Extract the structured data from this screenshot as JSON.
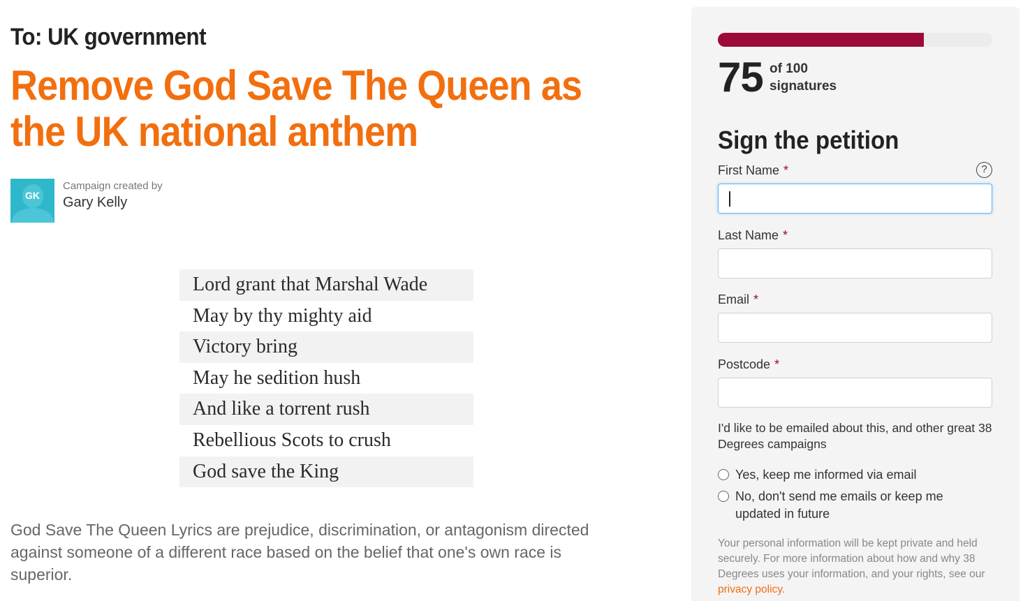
{
  "petition": {
    "to_line": "To: UK government",
    "title": "Remove God Save The Queen as the UK national anthem",
    "creator_label": "Campaign created by",
    "creator_name": "Gary Kelly",
    "creator_initials": "GK",
    "lyrics": [
      "Lord grant that Marshal Wade",
      "May by thy mighty aid",
      "Victory bring",
      "May he sedition hush",
      "And like a torrent rush",
      "Rebellious Scots to crush",
      "God save the King"
    ],
    "description": "God Save The Queen Lyrics are prejudice, discrimination, or antagonism directed against someone of a different race based on the belief that one's own race is superior."
  },
  "progress": {
    "count": "75",
    "of_label": "of 100",
    "signatures_label": "signatures",
    "fraction": 0.75,
    "fill_color": "#9b0a38"
  },
  "form": {
    "title": "Sign the petition",
    "required_mark": "*",
    "help_icon": "?",
    "first_name_label": "First Name",
    "last_name_label": "Last Name",
    "email_label": "Email",
    "postcode_label": "Postcode",
    "optin_text": "I'd like to be emailed about this, and other great 38 Degrees campaigns",
    "option_yes": "Yes, keep me informed via email",
    "option_no": "No, don't send me emails or keep me updated in future",
    "privacy_text": "Your personal information will be kept private and held securely. For more information about how and why 38 Degrees uses your information, and your rights, see our ",
    "privacy_link": "privacy policy",
    "privacy_end": "."
  },
  "colors": {
    "headline": "#f26f0f",
    "accent": "#9b0a38",
    "avatar": "#2fb8cc"
  }
}
